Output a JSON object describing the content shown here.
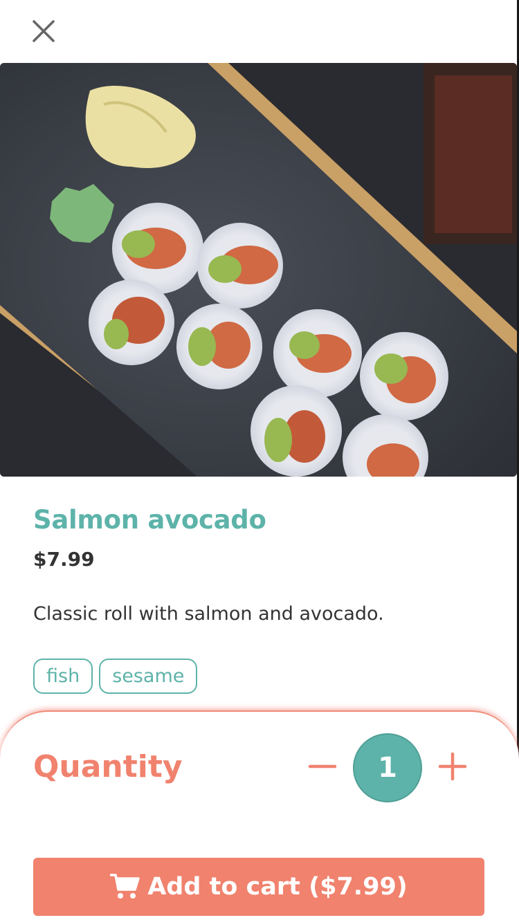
{
  "colors": {
    "accent": "#5db3a9",
    "secondary": "#f0826e",
    "text": "#333333"
  },
  "header": {
    "close_icon": "close-icon"
  },
  "product": {
    "image_icon": "product-photo",
    "name": "Salmon avocado",
    "price": "$7.99",
    "description": "Classic roll with salmon and avocado.",
    "tags": [
      "fish",
      "sesame"
    ]
  },
  "quantity": {
    "label": "Quantity",
    "value": "1",
    "decrement_icon": "minus-icon",
    "increment_icon": "plus-icon"
  },
  "cart_button": {
    "icon": "cart-icon",
    "label": "Add to cart ($7.99)"
  }
}
